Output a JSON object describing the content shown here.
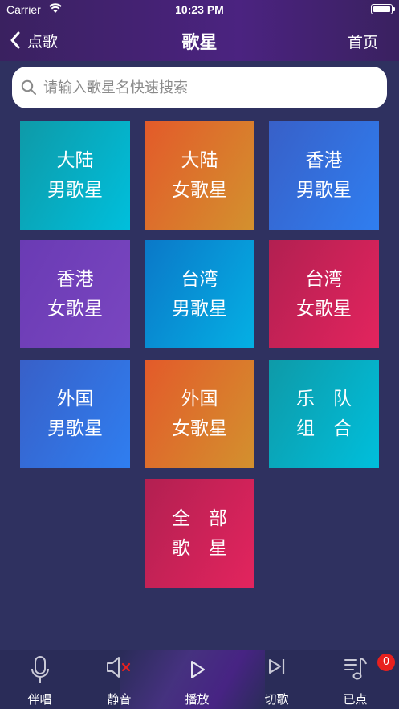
{
  "status_bar": {
    "carrier": "Carrier",
    "time": "10:23 PM"
  },
  "nav": {
    "back_label": "点歌",
    "title": "歌星",
    "home_label": "首页"
  },
  "search": {
    "placeholder": "请输入歌星名快速搜索"
  },
  "tiles": [
    {
      "line1": "大陆",
      "line2": "男歌星"
    },
    {
      "line1": "大陆",
      "line2": "女歌星"
    },
    {
      "line1": "香港",
      "line2": "男歌星"
    },
    {
      "line1": "香港",
      "line2": "女歌星"
    },
    {
      "line1": "台湾",
      "line2": "男歌星"
    },
    {
      "line1": "台湾",
      "line2": "女歌星"
    },
    {
      "line1": "外国",
      "line2": "男歌星"
    },
    {
      "line1": "外国",
      "line2": "女歌星"
    },
    {
      "line1": "乐　队",
      "line2": "组　合"
    },
    {
      "line1": "全　部",
      "line2": "歌　星"
    }
  ],
  "tabbar": {
    "items": [
      {
        "label": "伴唱",
        "icon": "microphone-icon"
      },
      {
        "label": "静音",
        "icon": "mute-icon"
      },
      {
        "label": "播放",
        "icon": "play-icon"
      },
      {
        "label": "切歌",
        "icon": "skip-icon"
      },
      {
        "label": "已点",
        "icon": "playlist-icon"
      }
    ],
    "queued_count": "0"
  },
  "colors": {
    "background": "#2f3160",
    "header": "#4b2380",
    "badge": "#e8201e"
  }
}
